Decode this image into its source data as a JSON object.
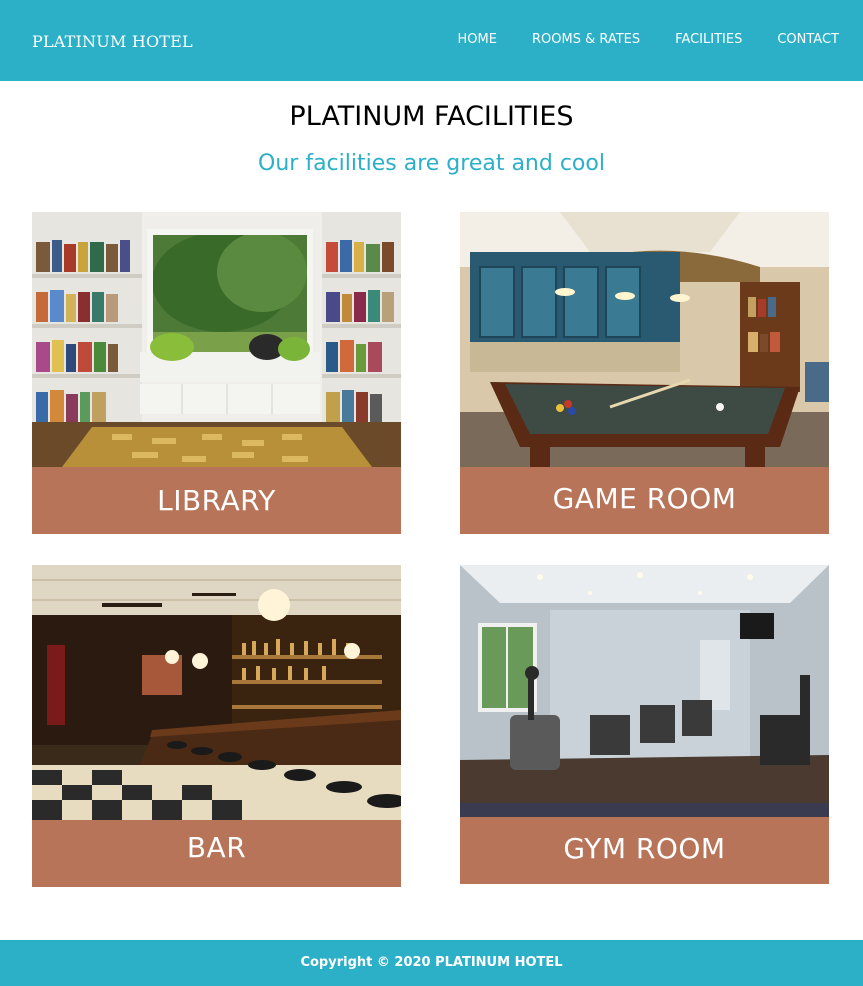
{
  "header": {
    "logo": "PLATINUM HOTEL",
    "nav": [
      "HOME",
      "ROOMS & RATES",
      "FACILITIES",
      "CONTACT"
    ]
  },
  "main": {
    "title": "PLATINUM FACILITIES",
    "subtitle": "Our facilities are great and cool",
    "facilities": [
      {
        "label": "LIBRARY"
      },
      {
        "label": "GAME ROOM"
      },
      {
        "label": "BAR"
      },
      {
        "label": "GYM ROOM"
      }
    ]
  },
  "footer": {
    "copyright": "Copyright © 2020 PLATINUM HOTEL"
  },
  "colors": {
    "header_bg": "#2cb0c8",
    "subtitle": "#2cb0c8",
    "caption_bg": "#b87459",
    "footer_bg": "#2cb0c8"
  }
}
